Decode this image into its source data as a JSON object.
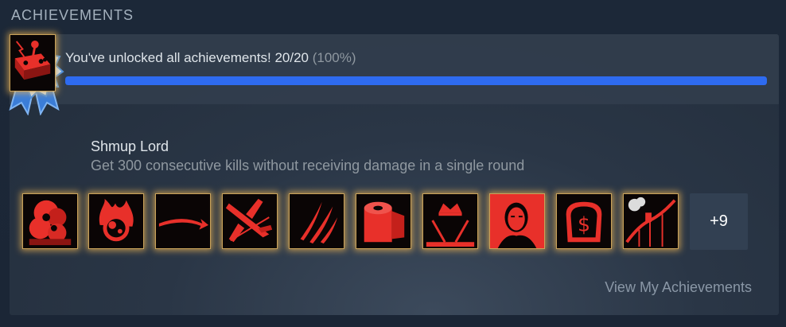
{
  "section": {
    "title": "ACHIEVEMENTS"
  },
  "progress": {
    "message": "You've unlocked all achievements! 20/20",
    "percent_label": "(100%)",
    "fraction": 1.0,
    "bar_color": "#2e6bf0"
  },
  "featured": {
    "name": "Shmup Lord",
    "description": "Get 300 consecutive kills without receiving damage in a single round",
    "icon": "arcade-joystick-icon"
  },
  "achievements": [
    {
      "icon": "explosion-icon"
    },
    {
      "icon": "flaming-bomb-icon"
    },
    {
      "icon": "swoosh-arrow-icon"
    },
    {
      "icon": "fighter-jet-icon"
    },
    {
      "icon": "claw-marks-icon"
    },
    {
      "icon": "toilet-paper-icon"
    },
    {
      "icon": "crown-swords-icon"
    },
    {
      "icon": "man-portrait-icon"
    },
    {
      "icon": "toast-dollar-icon"
    },
    {
      "icon": "roller-coaster-icon"
    }
  ],
  "more": {
    "label": "+9"
  },
  "footer": {
    "link_label": "View My Achievements"
  },
  "colors": {
    "accent_red": "#e8302a",
    "glow_gold": "#e8b050",
    "medal_gold": "#f7b90a",
    "medal_blue": "#4a8fe0"
  }
}
